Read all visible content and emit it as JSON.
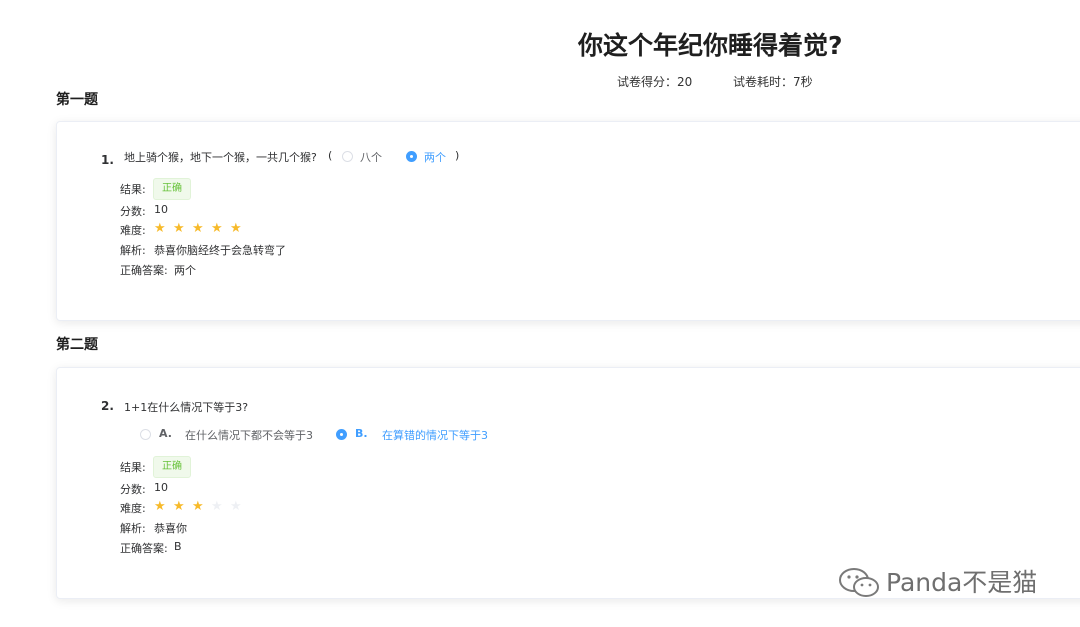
{
  "header": {
    "title": "你这个年纪你睡得着觉?",
    "score": "试卷得分：20",
    "time": "试卷耗时：7秒"
  },
  "sections": [
    {
      "title": "第一题",
      "number": "1.",
      "question": "地上骑个猴，地下一个猴，一共几个猴?",
      "open_paren": "(",
      "close_paren": ")",
      "options": [
        {
          "text": "八个",
          "selected": false
        },
        {
          "text": "两个",
          "selected": true
        }
      ],
      "result_label": "结果:",
      "result_tag": "正确",
      "score_label": "分数:",
      "score_value": "10",
      "difficulty_label": "难度:",
      "difficulty_rating": 5,
      "difficulty_max": 5,
      "analysis_label": "解析:",
      "analysis_text": "恭喜你脑经终于会急转弯了",
      "answer_label": "正确答案:",
      "answer_value": "两个"
    },
    {
      "title": "第二题",
      "number": "2.",
      "question": "1+1在什么情况下等于3?",
      "options": [
        {
          "letter": "A.",
          "text": "在什么情况下都不会等于3",
          "selected": false
        },
        {
          "letter": "B.",
          "text": "在算错的情况下等于3",
          "selected": true
        }
      ],
      "result_label": "结果:",
      "result_tag": "正确",
      "score_label": "分数:",
      "score_value": "10",
      "difficulty_label": "难度:",
      "difficulty_rating": 3,
      "difficulty_max": 5,
      "analysis_label": "解析:",
      "analysis_text": "恭喜你",
      "answer_label": "正确答案:",
      "answer_value": "B"
    }
  ],
  "colors": {
    "accent": "#409eff",
    "success": "#67c23a",
    "star_on": "#f7ba2a",
    "star_off": "#eef0f4"
  },
  "watermark": "Panda不是猫",
  "icons": {
    "star": "star-icon",
    "watermark": "wechat-icon"
  }
}
